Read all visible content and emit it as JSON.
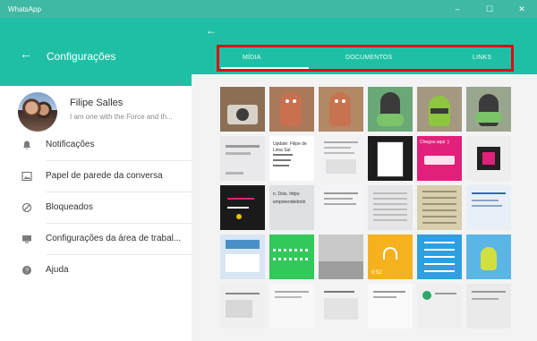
{
  "window": {
    "title": "WhatsApp",
    "minimize": "–",
    "maximize": "☐",
    "close": "✕"
  },
  "settings": {
    "back_icon": "←",
    "title": "Configurações",
    "profile": {
      "name": "Filipe Salles",
      "status": "I am one with the Force and th..."
    },
    "items": [
      {
        "icon": "bell-icon",
        "glyph": "🔔",
        "label": "Notificações"
      },
      {
        "icon": "wallpaper-icon",
        "glyph": "▦",
        "label": "Papel de parede da conversa"
      },
      {
        "icon": "blocked-icon",
        "glyph": "⊘",
        "label": "Bloqueados"
      },
      {
        "icon": "desktop-icon",
        "glyph": "▭",
        "label": "Configurações da área de trabal..."
      },
      {
        "icon": "help-icon",
        "glyph": "?",
        "label": "Ajuda"
      }
    ]
  },
  "media": {
    "back_icon": "←",
    "tabs": [
      {
        "label": "MÍDIA"
      },
      {
        "label": "DOCUMENTOS"
      },
      {
        "label": "LINKS"
      }
    ],
    "active_tab": 0,
    "thumb_text": {
      "r1c1": "Update: Filipe de Lima Sal",
      "r1c2": "Chegou aqui :)",
      "r2c1": "n. Dois. https:",
      "r2c2": "empreendedorin",
      "audio_time": "0:52"
    },
    "thumbs": [
      [
        "#8b6f55",
        "#c8704f",
        "#c8734f",
        "#6aa878",
        "#7fae6c",
        "#9aa58d"
      ],
      [
        "#e9e9ec",
        "#ffffff",
        "#f2f2f4",
        "#111111",
        "#e0207a",
        "#eeeeee"
      ],
      [
        "#1a1a1a",
        "#dfe0e3",
        "#f4f4f6",
        "#e6e6e8",
        "#d8cfae",
        "#e9eff6"
      ],
      [
        "#d7e6f2",
        "#33c85a",
        "#c9c9c9",
        "#f5b21e",
        "#2f9fe0",
        "#5bb6e6"
      ],
      [
        "#f0f0f0",
        "#f8f8f8",
        "#f3f3f3",
        "#fafafa",
        "#efefef",
        "#eaeaea"
      ]
    ]
  }
}
